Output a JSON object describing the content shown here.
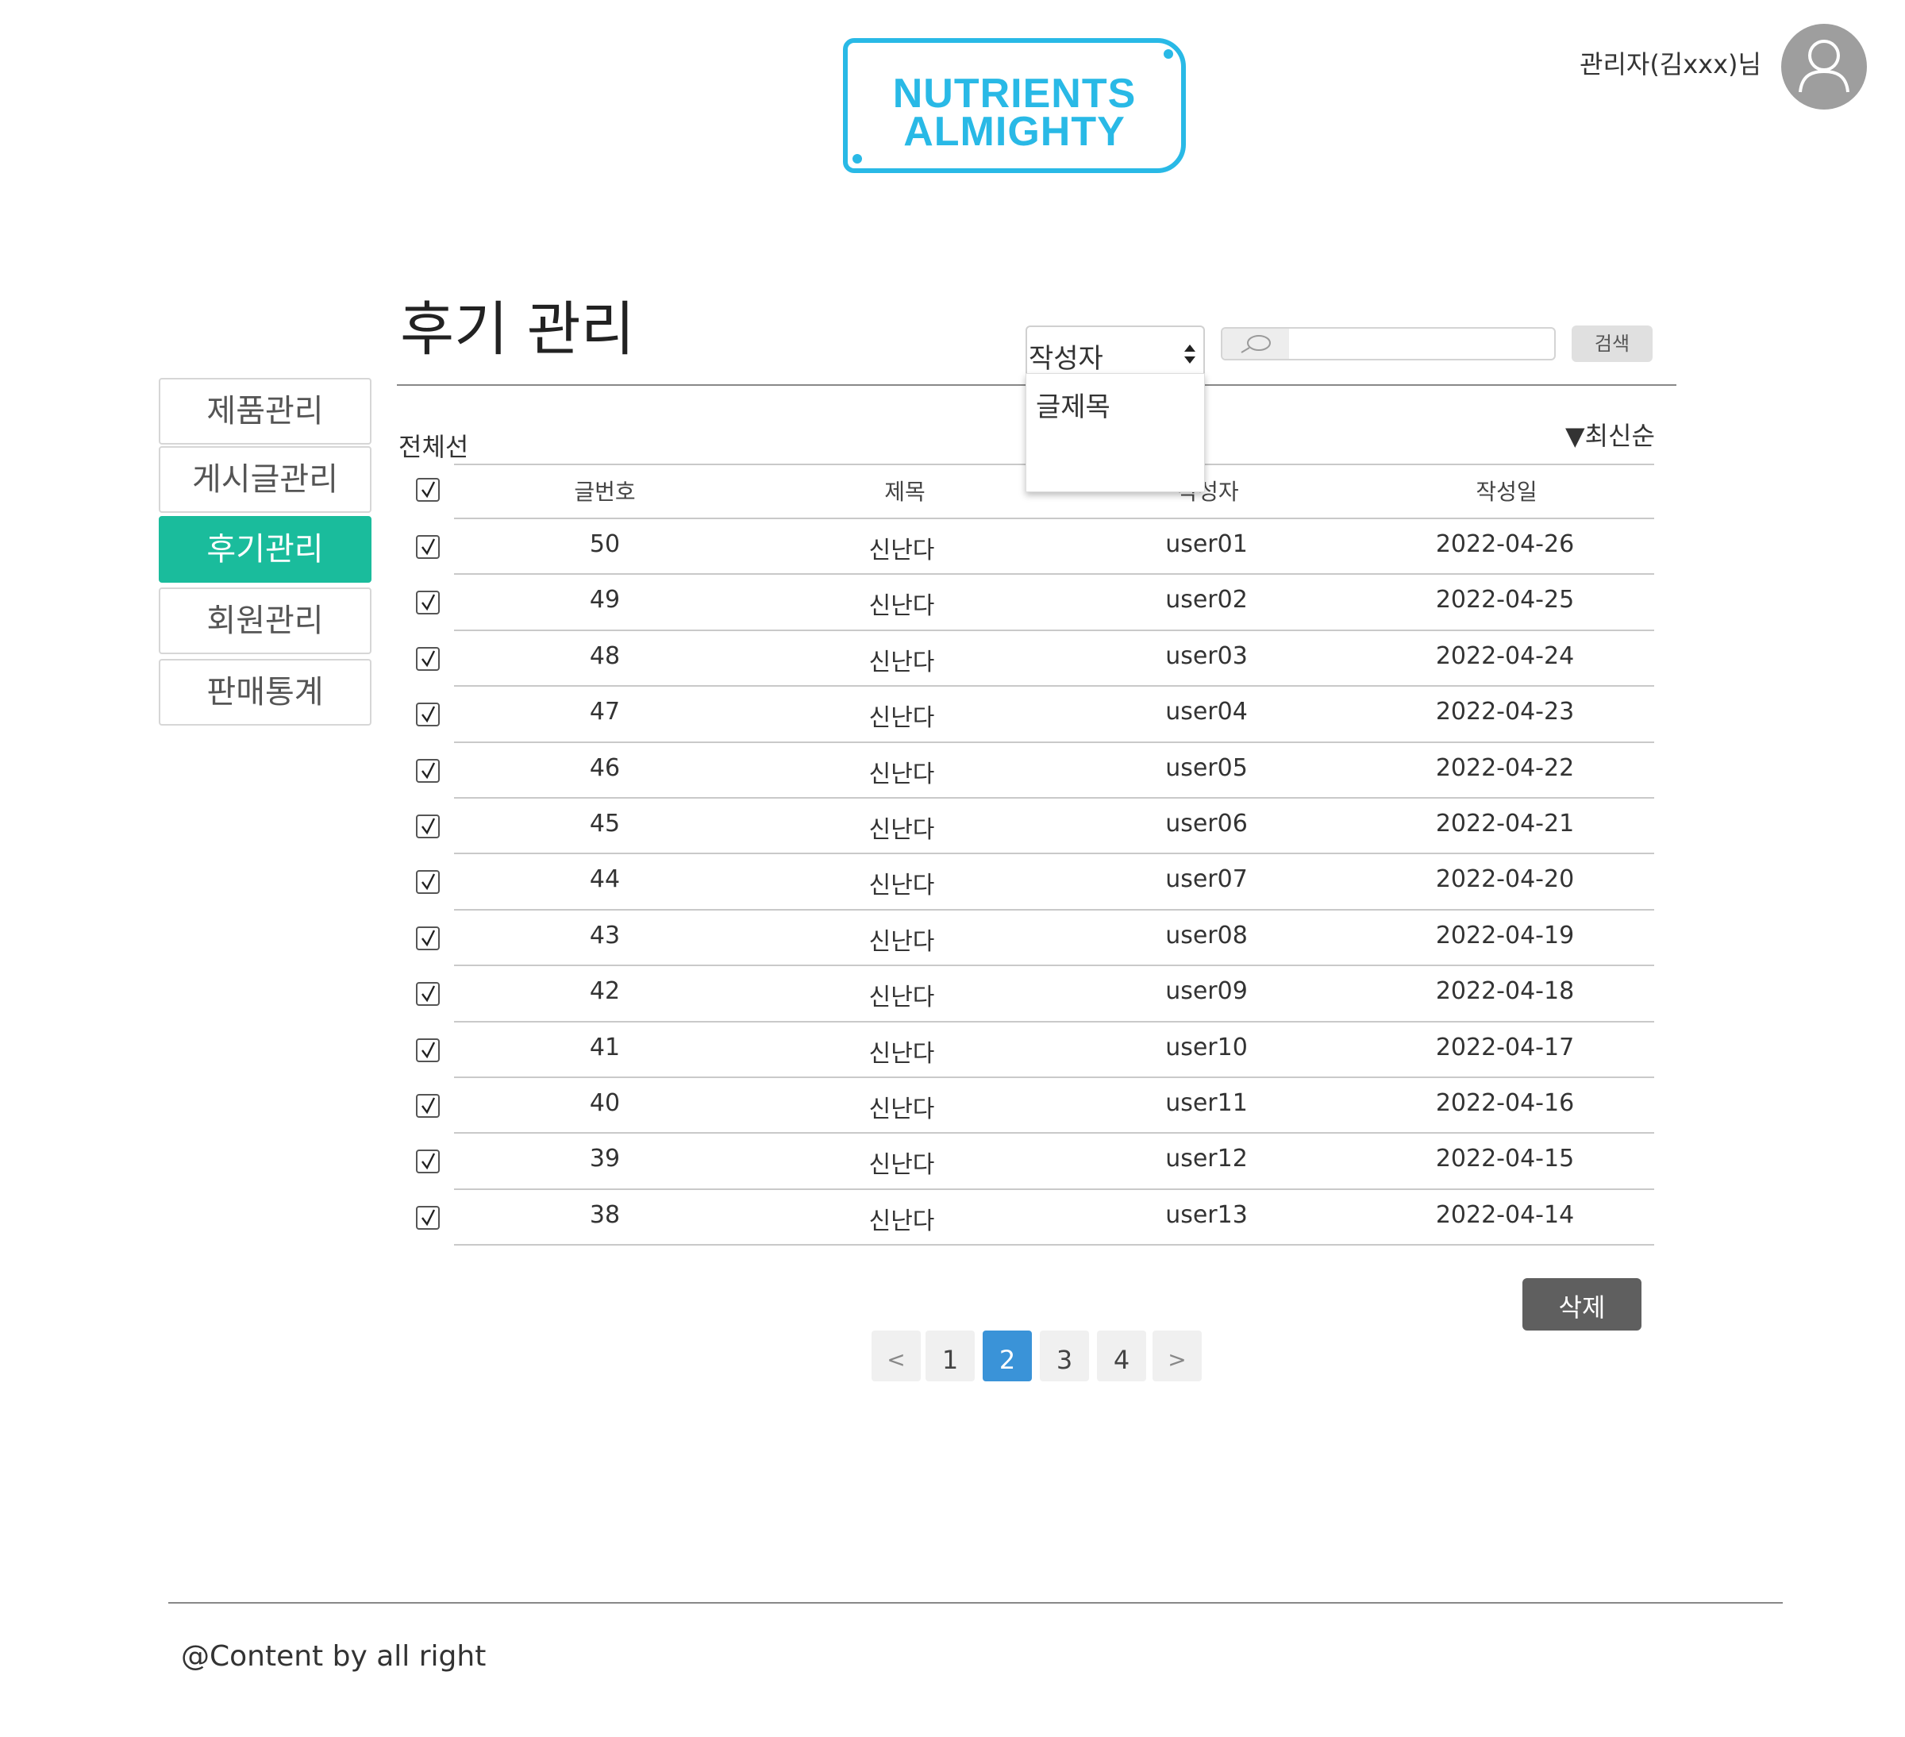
{
  "header": {
    "logo_line1": "NUTRIENTS",
    "logo_line2": "ALMIGHTY",
    "user_name": "관리자(김xxx)님",
    "brand_color": "#29b9e6",
    "avatar_icon": "user-silhouette-icon"
  },
  "sidebar": {
    "items": [
      {
        "label": "제품관리",
        "active": false
      },
      {
        "label": "게시글관리",
        "active": false
      },
      {
        "label": "후기관리",
        "active": true
      },
      {
        "label": "회원관리",
        "active": false
      },
      {
        "label": "판매통계",
        "active": false
      }
    ],
    "active_color": "#1abc9c"
  },
  "main": {
    "title": "후기 관리",
    "search": {
      "filter_selected": "작성자",
      "filter_options": [
        "글제목"
      ],
      "input_value": "",
      "button_label": "검색",
      "icon": "search-icon"
    },
    "select_all_label": "전체선",
    "sort_label": "▼최신순",
    "table": {
      "headers": [
        "글번호",
        "제목",
        "작성자",
        "작성일"
      ],
      "rows": [
        {
          "no": "50",
          "title": "신난다",
          "author": "user01",
          "date": "2022-04-26",
          "checked": true
        },
        {
          "no": "49",
          "title": "신난다",
          "author": "user02",
          "date": "2022-04-25",
          "checked": true
        },
        {
          "no": "48",
          "title": "신난다",
          "author": "user03",
          "date": "2022-04-24",
          "checked": true
        },
        {
          "no": "47",
          "title": "신난다",
          "author": "user04",
          "date": "2022-04-23",
          "checked": true
        },
        {
          "no": "46",
          "title": "신난다",
          "author": "user05",
          "date": "2022-04-22",
          "checked": true
        },
        {
          "no": "45",
          "title": "신난다",
          "author": "user06",
          "date": "2022-04-21",
          "checked": true
        },
        {
          "no": "44",
          "title": "신난다",
          "author": "user07",
          "date": "2022-04-20",
          "checked": true
        },
        {
          "no": "43",
          "title": "신난다",
          "author": "user08",
          "date": "2022-04-19",
          "checked": true
        },
        {
          "no": "42",
          "title": "신난다",
          "author": "user09",
          "date": "2022-04-18",
          "checked": true
        },
        {
          "no": "41",
          "title": "신난다",
          "author": "user10",
          "date": "2022-04-17",
          "checked": true
        },
        {
          "no": "40",
          "title": "신난다",
          "author": "user11",
          "date": "2022-04-16",
          "checked": true
        },
        {
          "no": "39",
          "title": "신난다",
          "author": "user12",
          "date": "2022-04-15",
          "checked": true
        },
        {
          "no": "38",
          "title": "신난다",
          "author": "user13",
          "date": "2022-04-14",
          "checked": true
        }
      ]
    },
    "delete_label": "삭제",
    "pagination": {
      "prev": "<",
      "pages": [
        "1",
        "2",
        "3",
        "4"
      ],
      "current": "2",
      "next": ">",
      "active_color": "#3a93d8"
    }
  },
  "footer": {
    "text": "@Content by all right"
  }
}
